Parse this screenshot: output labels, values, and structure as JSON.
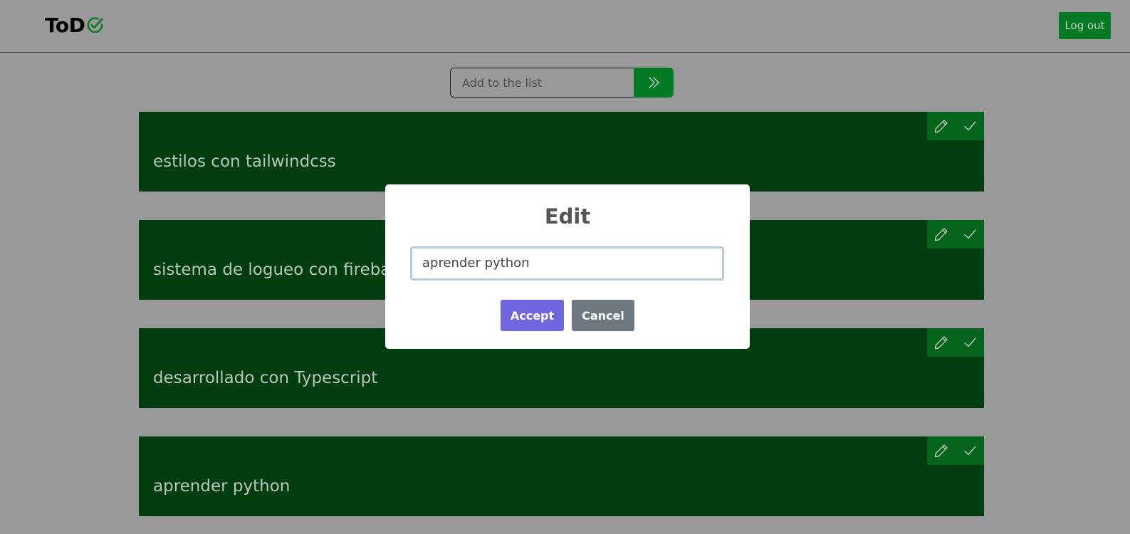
{
  "header": {
    "logo_text": "ToD",
    "logout_label": "Log out"
  },
  "add_form": {
    "placeholder": "Add to the list"
  },
  "tasks": [
    {
      "text": "estilos con tailwindcss"
    },
    {
      "text": "sistema de logueo con firebase"
    },
    {
      "text": "desarrollado con Typescript"
    },
    {
      "text": "aprender python"
    }
  ],
  "modal": {
    "title": "Edit",
    "input_value": "aprender python",
    "accept_label": "Accept",
    "cancel_label": "Cancel"
  },
  "colors": {
    "accent_green": "#047a25",
    "task_bg": "#023d10",
    "accept": "#7066e0",
    "cancel": "#6e7881"
  }
}
